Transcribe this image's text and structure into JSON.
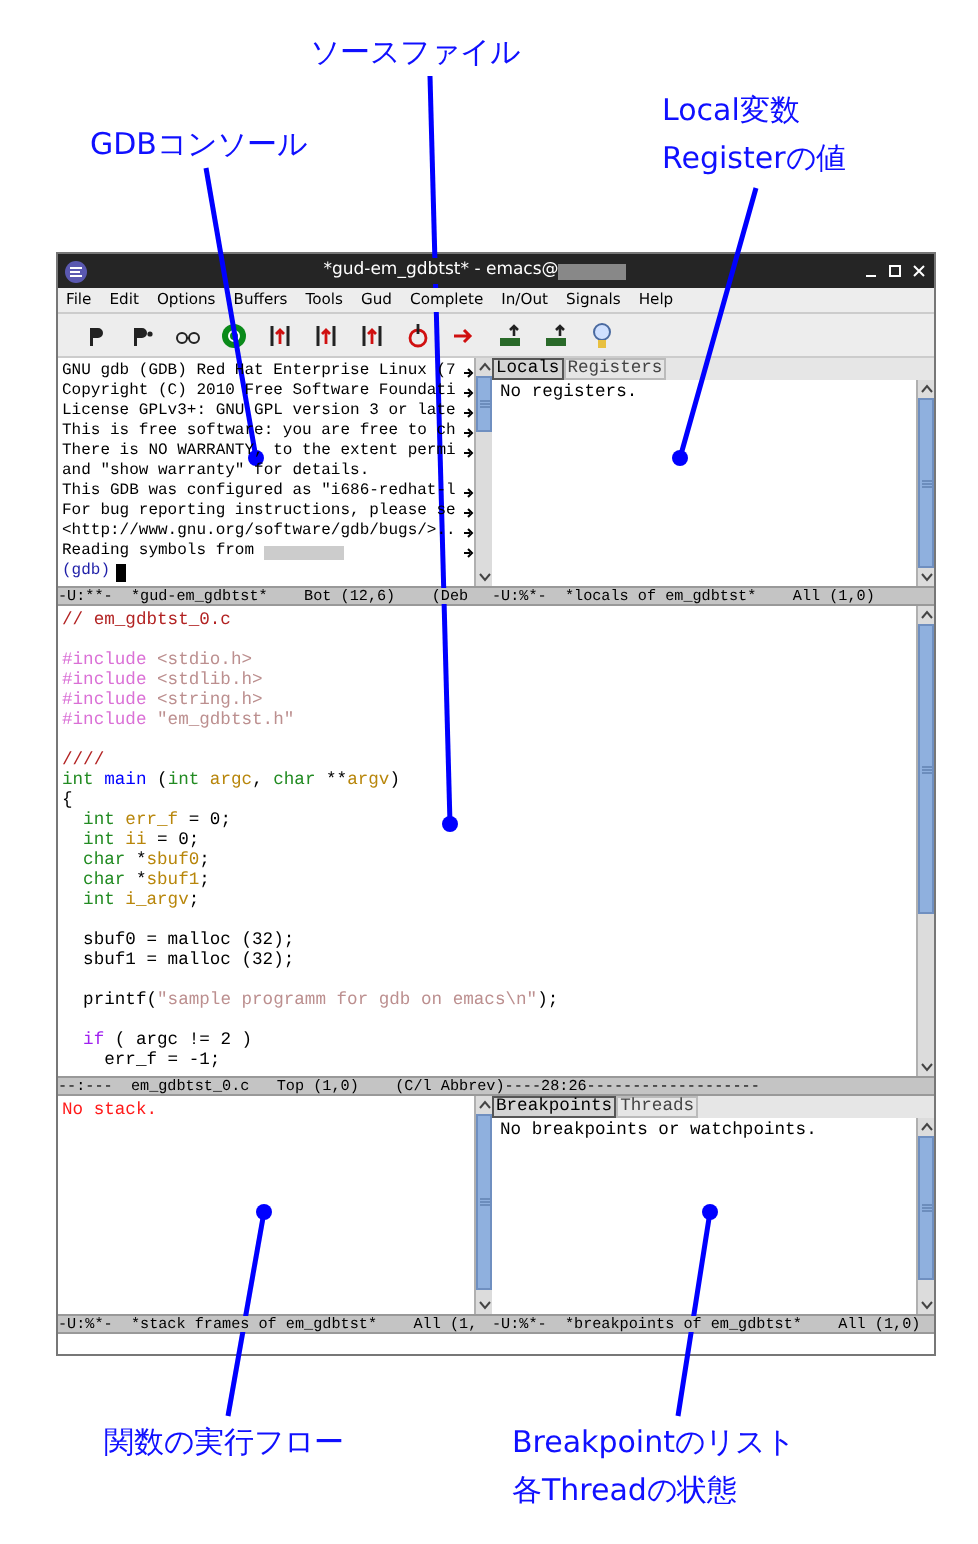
{
  "annotations": [
    {
      "lines": [
        "ソースファイル"
      ]
    },
    {
      "lines": [
        "GDBコンソール"
      ]
    },
    {
      "lines": [
        "Local変数",
        "Registerの値"
      ]
    },
    {
      "lines": [
        "関数の実行フロー"
      ]
    },
    {
      "lines": [
        "Breakpointのリスト",
        "各Threadの状態"
      ]
    }
  ],
  "window": {
    "title": "*gud-em_gdbtst* - emacs@"
  },
  "menu": [
    "File",
    "Edit",
    "Options",
    "Buffers",
    "Tools",
    "Gud",
    "Complete",
    "In/Out",
    "Signals",
    "Help"
  ],
  "gdb_console": {
    "lines": [
      {
        "text": "GNU gdb (GDB) Red Hat Enterprise Linux (7",
        "truncated": true
      },
      {
        "text": "Copyright (C) 2010 Free Software Foundati",
        "truncated": true
      },
      {
        "text": "License GPLv3+: GNU GPL version 3 or late",
        "truncated": true
      },
      {
        "text": "This is free software: you are free to ch",
        "truncated": true
      },
      {
        "text": "There is NO WARRANTY, to the extent permi",
        "truncated": true
      },
      {
        "text": "and \"show warranty\" for details.",
        "truncated": false
      },
      {
        "text": "This GDB was configured as \"i686-redhat-l",
        "truncated": true
      },
      {
        "text": "For bug reporting instructions, please se",
        "truncated": true
      },
      {
        "text": "<http://www.gnu.org/software/gdb/bugs/>..",
        "truncated": true
      },
      {
        "text": "Reading symbols from ",
        "truncated": true,
        "redacted": true
      }
    ],
    "prompt": "(gdb)"
  },
  "locals_pane": {
    "tabs": [
      {
        "label": "Locals",
        "selected": true
      },
      {
        "label": "Registers",
        "selected": false
      }
    ],
    "text": "No registers."
  },
  "modeline_top": [
    "-U:**-  *gud-em_gdbtst*    Bot (12,6)    (Deb",
    "-U:%*-  *locals of em_gdbtst*    All (1,0)"
  ],
  "source": {
    "lines": [
      {
        "tokens": [
          {
            "text": "// em_gdbtst_0.c",
            "kind": "comment"
          }
        ]
      },
      {
        "space_before": true,
        "tokens": [
          {
            "text": "#include",
            "kind": "preprocessor"
          },
          {
            "text": " <stdio.h>",
            "kind": "string"
          }
        ]
      },
      {
        "tokens": [
          {
            "text": "#include",
            "kind": "preprocessor"
          },
          {
            "text": " <stdlib.h>",
            "kind": "string"
          }
        ]
      },
      {
        "tokens": [
          {
            "text": "#include",
            "kind": "preprocessor"
          },
          {
            "text": " <string.h>",
            "kind": "string"
          }
        ]
      },
      {
        "tokens": [
          {
            "text": "#include",
            "kind": "preprocessor"
          },
          {
            "text": " \"em_gdbtst.h\"",
            "kind": "string"
          }
        ]
      },
      {
        "space_before": true,
        "tokens": [
          {
            "text": "////",
            "kind": "comment"
          }
        ]
      },
      {
        "tokens": [
          {
            "text": "int",
            "kind": "type"
          },
          {
            "text": " main",
            "kind": "function"
          },
          {
            "text": " (",
            "kind": "plain"
          },
          {
            "text": "int",
            "kind": "type"
          },
          {
            "text": " argc",
            "kind": "variable"
          },
          {
            "text": ", ",
            "kind": "plain"
          },
          {
            "text": "char",
            "kind": "type"
          },
          {
            "text": " **",
            "kind": "plain"
          },
          {
            "text": "argv",
            "kind": "variable"
          },
          {
            "text": ")",
            "kind": "plain"
          }
        ]
      },
      {
        "tokens": [
          {
            "text": "{",
            "kind": "plain"
          }
        ]
      },
      {
        "tokens": [
          {
            "text": "  int",
            "kind": "type"
          },
          {
            "text": " err_f",
            "kind": "variable"
          },
          {
            "text": " = 0;",
            "kind": "plain"
          }
        ]
      },
      {
        "tokens": [
          {
            "text": "  int",
            "kind": "type"
          },
          {
            "text": " ii",
            "kind": "variable"
          },
          {
            "text": " = 0;",
            "kind": "plain"
          }
        ]
      },
      {
        "tokens": [
          {
            "text": "  char",
            "kind": "type"
          },
          {
            "text": " *",
            "kind": "plain"
          },
          {
            "text": "sbuf0",
            "kind": "variable"
          },
          {
            "text": ";",
            "kind": "plain"
          }
        ]
      },
      {
        "tokens": [
          {
            "text": "  char",
            "kind": "type"
          },
          {
            "text": " *",
            "kind": "plain"
          },
          {
            "text": "sbuf1",
            "kind": "variable"
          },
          {
            "text": ";",
            "kind": "plain"
          }
        ]
      },
      {
        "tokens": [
          {
            "text": "  int",
            "kind": "type"
          },
          {
            "text": " i_argv",
            "kind": "variable"
          },
          {
            "text": ";",
            "kind": "plain"
          }
        ]
      },
      {
        "space_before": true,
        "tokens": [
          {
            "text": "  sbuf0 = malloc (32);",
            "kind": "plain"
          }
        ]
      },
      {
        "tokens": [
          {
            "text": "  sbuf1 = malloc (32);",
            "kind": "plain"
          }
        ]
      },
      {
        "space_before": true,
        "tokens": [
          {
            "text": "  printf(",
            "kind": "plain"
          },
          {
            "text": "\"sample programm for gdb on emacs\\n\"",
            "kind": "string"
          },
          {
            "text": ");",
            "kind": "plain"
          }
        ]
      },
      {
        "space_before": true,
        "tokens": [
          {
            "text": "  if",
            "kind": "keyword"
          },
          {
            "text": " ( argc != 2 )",
            "kind": "plain"
          }
        ]
      },
      {
        "tokens": [
          {
            "text": "    err_f = -1;",
            "kind": "plain"
          }
        ]
      }
    ]
  },
  "modeline_source": "--:---  em_gdbtst_0.c   Top (1,0)    (C/l Abbrev)----28:26-------------------",
  "stack_pane": {
    "text": "No stack."
  },
  "breakpoints_pane": {
    "tabs": [
      {
        "label": "Breakpoints",
        "selected": true
      },
      {
        "label": "Threads",
        "selected": false
      }
    ],
    "text": "No breakpoints or watchpoints."
  },
  "modeline_bottom": [
    "-U:%*-  *stack frames of em_gdbtst*    All (1,",
    "-U:%*-  *breakpoints of em_gdbtst*    All (1,0)"
  ]
}
